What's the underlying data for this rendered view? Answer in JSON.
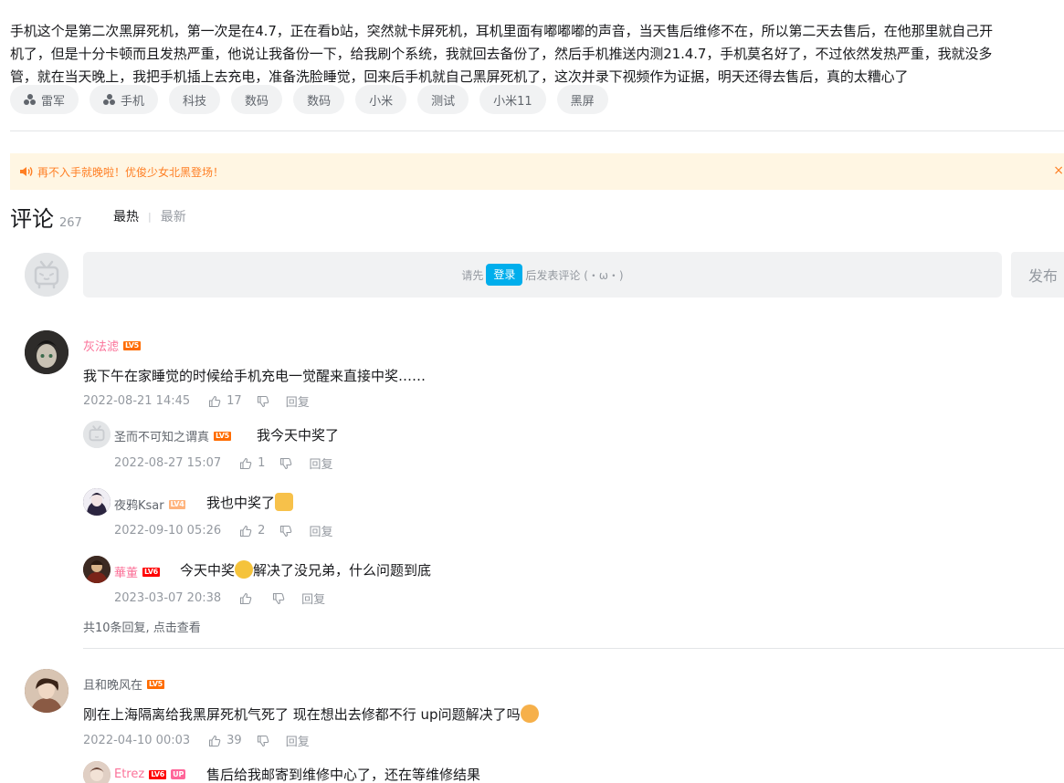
{
  "description": {
    "lines": [
      "手机这个是第二次黑屏死机，第一次是在4.7，正在看b站，突然就卡屏死机，耳机里面有嘟嘟嘟的声音，当天售后维修不在，所以第二天去售后，在他那里就自己开",
      "机了，但是十分卡顿而且发热严重，他说让我备份一下，给我刷个系统，我就回去备份了，然后手机推送内测21.4.7，手机莫名好了，不过依然发热严重，我就没多",
      "管，就在当天晚上，我把手机插上去充电，准备洗脸睡觉，回来后手机就自己黑屏死机了，这次并录下视频作为证据，明天还得去售后，真的太糟心了"
    ]
  },
  "tags": [
    {
      "label": "雷军",
      "icon": "topic-icon"
    },
    {
      "label": "手机",
      "icon": "topic-icon"
    },
    {
      "label": "科技"
    },
    {
      "label": "数码"
    },
    {
      "label": "数码"
    },
    {
      "label": "小米"
    },
    {
      "label": "测试"
    },
    {
      "label": "小米11"
    },
    {
      "label": "黑屏"
    }
  ],
  "notice": {
    "text": "再不入手就晚啦！优俊少女北黑登场！",
    "close": "×"
  },
  "comments_header": {
    "title": "评论",
    "count": "267",
    "sort_hot": "最热",
    "sort_sep": "|",
    "sort_new": "最新"
  },
  "reply_box": {
    "prefix": "请先",
    "login": "登录",
    "suffix": "后发表评论 (・ω・)",
    "publish": "发布"
  },
  "comments": [
    {
      "user": "灰法滤",
      "level": "LV5",
      "text": "我下午在家睡觉的时候给手机充电一觉醒来直接中奖……",
      "time": "2022-08-21 14:45",
      "likes": "17",
      "reply_label": "回复",
      "replies": [
        {
          "user": "圣而不可知之谓真",
          "level": "LV5",
          "text": "我今天中奖了",
          "time": "2022-08-27 15:07",
          "likes": "1",
          "reply_label": "回复"
        },
        {
          "user": "夜鸦Ksar",
          "level": "LV4",
          "text": "我也中奖了",
          "time": "2022-09-10 05:26",
          "likes": "2",
          "reply_label": "回复"
        },
        {
          "user": "華董",
          "level": "LV6",
          "text_a": "今天中奖",
          "text_b": "解决了没兄弟，什么问题到底",
          "time": "2023-03-07 20:38",
          "likes": "",
          "reply_label": "回复"
        }
      ],
      "more": "共10条回复, 点击查看"
    },
    {
      "user": "且和晚风在",
      "level": "LV5",
      "text": "刚在上海隔离给我黑屏死机气死了  现在想出去修都不行  up问题解决了吗",
      "time": "2022-04-10 00:03",
      "likes": "39",
      "reply_label": "回复",
      "replies": [
        {
          "user": "Etrez",
          "level": "LV6",
          "badge": "UP",
          "text": "售后给我邮寄到维修中心了，还在等维修结果"
        }
      ]
    }
  ],
  "colors": {
    "accent": "#00aeec",
    "pink_name": "#fb7299",
    "notice_bg": "#fff6e3",
    "notice_text": "#ff7f24"
  }
}
